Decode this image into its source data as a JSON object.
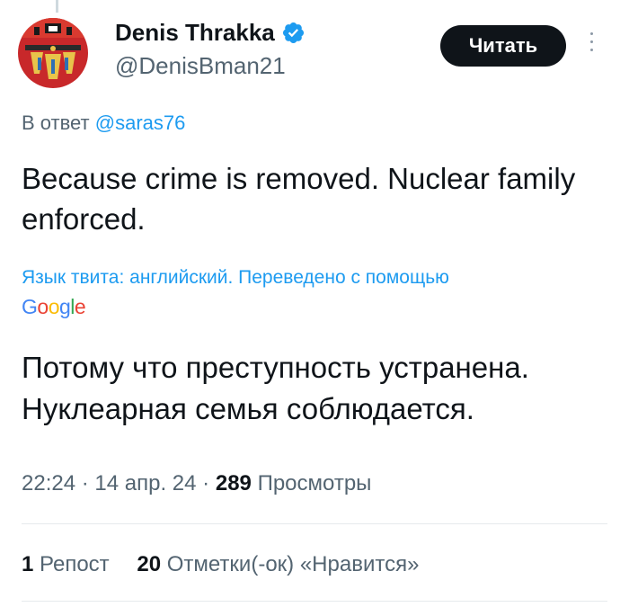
{
  "author": {
    "name": "Denis Thrakka",
    "handle": "@DenisBman21",
    "verified_color": "#1d9bf0"
  },
  "follow_button": {
    "label": "Читать"
  },
  "more_menu": {
    "icon": "more-vertical-icon"
  },
  "reply": {
    "prefix": "В ответ",
    "mention": "@saras76"
  },
  "tweet": {
    "text": "Because crime is removed. Nuclear family enforced.",
    "translation_info": "Язык твита: английский. Переведено с помощью",
    "translator": "Google",
    "translated_text": "Потому что преступность устранена. Нуклеарная семья соблюдается."
  },
  "meta": {
    "time": "22:24",
    "date": "14 апр. 24",
    "views_count": "289",
    "views_label": "Просмотры",
    "separator": "·"
  },
  "stats": {
    "reposts_count": "1",
    "reposts_label": "Репост",
    "likes_count": "20",
    "likes_label": "Отметки(-ок) «Нравится»"
  },
  "colors": {
    "accent": "#1d9bf0",
    "text": "#0f1419",
    "muted": "#536471"
  }
}
